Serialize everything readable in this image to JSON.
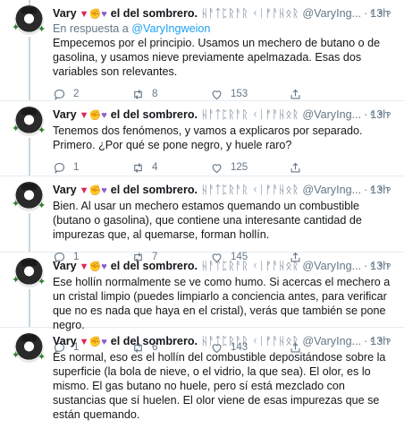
{
  "tweets": [
    {
      "name": "Vary",
      "emojis": "▼✊💜",
      "name_suffix": "el del sombrero.",
      "runes": "ᚺᚨᛏᛈᚱᚨᚱ ᚲᛁᚠᚨᚺᛟᚱ",
      "handle": "@VaryIng...",
      "time": "13h",
      "reply_prefix": "En respuesta a",
      "reply_handle": "@VaryIngweion",
      "text": "Empecemos por el principio. Usamos un mechero de butano o de gasolina, y usamos nieve previamente apelmazada. Esas dos variables son relevantes.",
      "replies": "2",
      "retweets": "8",
      "likes": "153"
    },
    {
      "name": "Vary",
      "emojis": "▼✊💜",
      "name_suffix": "el del sombrero.",
      "runes": "ᚺᚨᛏᛈᚱᚨᚱ ᚲᛁᚠᚨᚺᛟᚱ",
      "handle": "@VaryIng...",
      "time": "13h",
      "text": "Tenemos dos fenómenos, y vamos a explicaros por separado. Primero. ¿Por qué se pone negro, y huele raro?",
      "replies": "1",
      "retweets": "4",
      "likes": "125"
    },
    {
      "name": "Vary",
      "emojis": "▼✊💜",
      "name_suffix": "el del sombrero.",
      "runes": "ᚺᚨᛏᛈᚱᚨᚱ ᚲᛁᚠᚨᚺᛟᚱ",
      "handle": "@VaryIng...",
      "time": "13h",
      "text": "Bien. Al usar un mechero estamos quemando un combustible (butano o gasolina), que contiene una interesante cantidad de impurezas que, al quemarse, forman hollín.",
      "replies": "1",
      "retweets": "7",
      "likes": "145"
    },
    {
      "name": "Vary",
      "emojis": "▼✊💜",
      "name_suffix": "el del sombrero.",
      "runes": "ᚺᚨᛏᛈᚱᚨᚱ ᚲᛁᚠᚨᚺᛟᚱ",
      "handle": "@VaryIng...",
      "time": "13h",
      "text": "Ese hollín normalmente se ve como humo. Si acercas el mechero a un cristal limpio (puedes limpiarlo a conciencia antes, para verificar que no es nada que haya en el cristal), verás que también se pone negro.",
      "replies": "1",
      "retweets": "6",
      "likes": "143"
    },
    {
      "name": "Vary",
      "emojis": "▼✊💜",
      "name_suffix": "el del sombrero.",
      "runes": "ᚺᚨᛏᛈᚱᚨᚱ ᚲᛁᚠᚨᚺᛟᚱ",
      "handle": "@VaryIng...",
      "time": "13h",
      "text": "Es normal, eso es el hollín del combustible depositándose sobre la superficie (la bola de nieve, o el vidrio, la que sea). El olor, es lo mismo. El gas butano no huele, pero sí está mezclado con sustancias que sí huelen. El olor viene de esas impurezas que se están quemando.",
      "replies": "",
      "retweets": "",
      "likes": ""
    }
  ],
  "separator": "·",
  "more_glyph": "∘∘∘",
  "colors": {
    "accent": "#1da1f2",
    "muted": "#657786",
    "border": "#e6ecf0"
  },
  "icons": [
    "reply-icon",
    "retweet-icon",
    "like-icon",
    "share-icon",
    "more-icon"
  ]
}
